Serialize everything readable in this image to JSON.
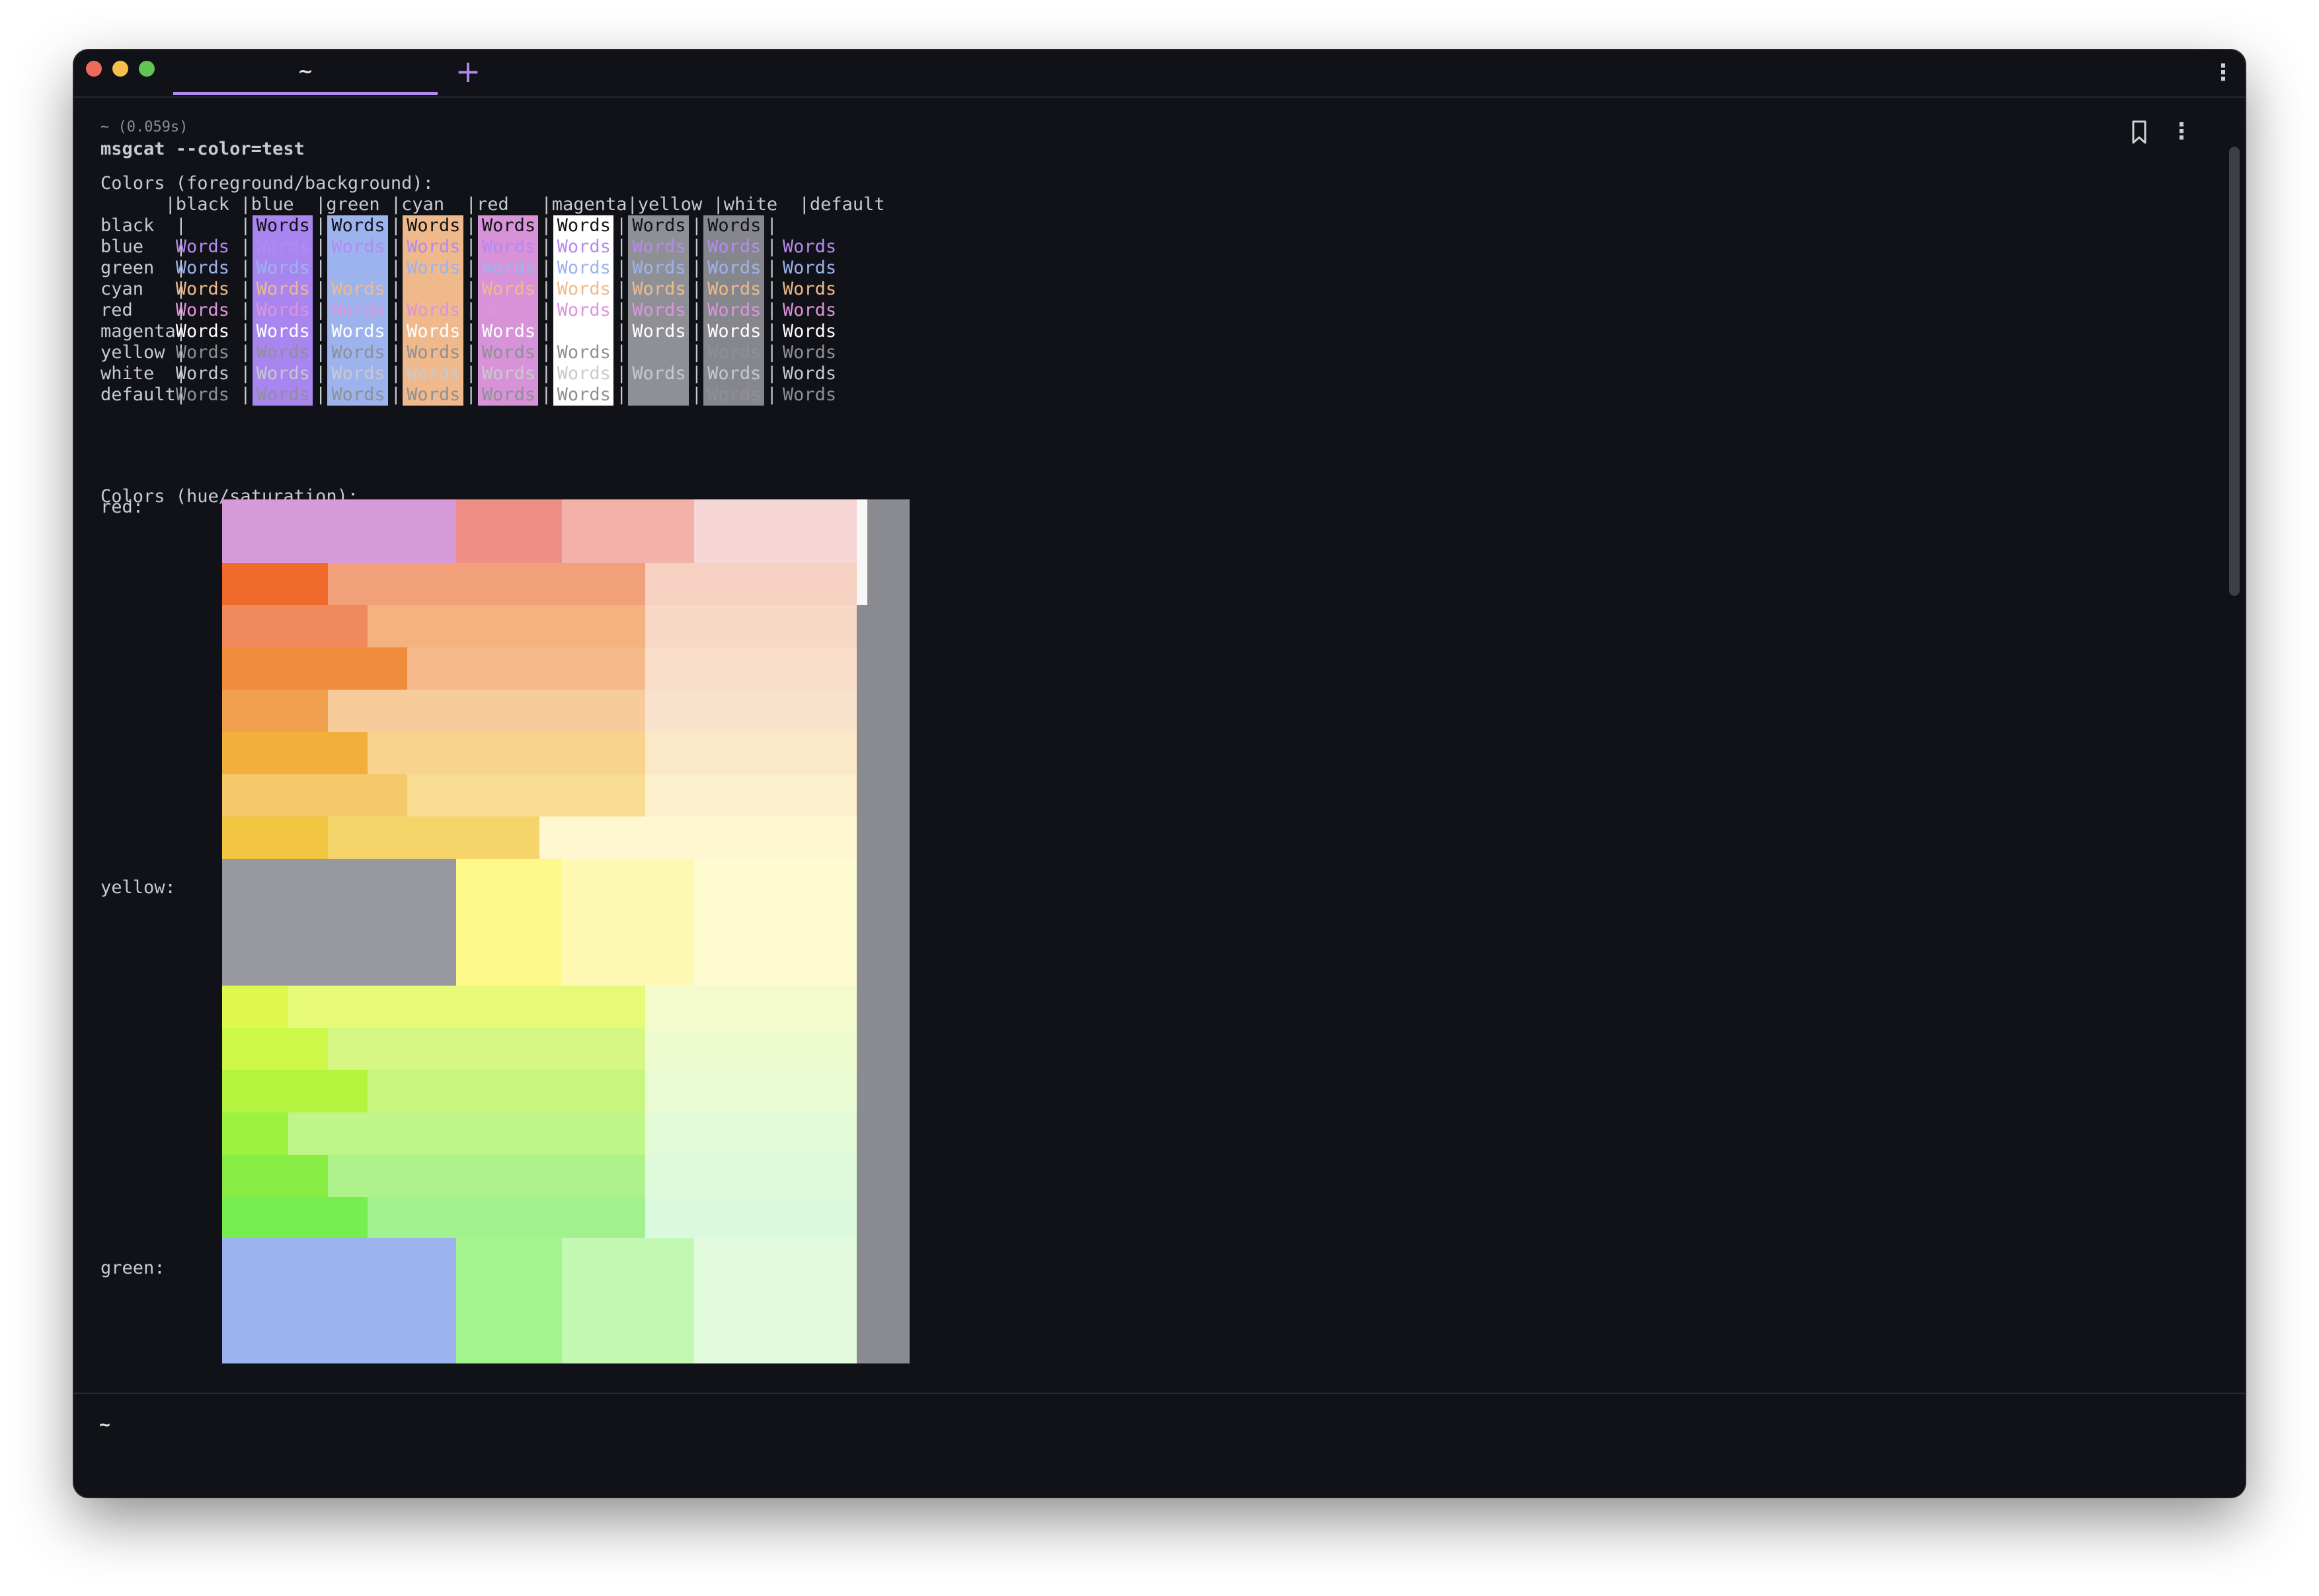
{
  "window": {
    "tab_title": "~",
    "new_tab_label": "+",
    "menu_label": "⋮"
  },
  "block": {
    "header": "~ (0.059s)",
    "command": "msgcat --color=test",
    "more_label": "⋮"
  },
  "colors_section": {
    "title": "Colors (foreground/background):",
    "column_header": "      |black |blue  |green |cyan  |red   |magenta|yellow |white  |default",
    "row_labels": [
      "black  ",
      "blue   ",
      "green  ",
      "cyan   ",
      "red    ",
      "magenta",
      "yellow ",
      "white  ",
      "default"
    ],
    "cell_text": "Words",
    "backgrounds": {
      "black": "#111217",
      "blue": "#a885ef",
      "green": "#9db3ee",
      "cyan": "#efb98c",
      "red": "#d892d8",
      "magenta": "#ffffff",
      "yellow": "#8f9096",
      "white": "#86878d",
      "default": "#111217"
    },
    "foregrounds": {
      "black": "#111217",
      "blue": "#b48af2",
      "green": "#9db3ee",
      "cyan": "#f0b98a",
      "red": "#dd94dc",
      "magenta": "#ffffff",
      "yellow": "#8f9096",
      "white": "#c8cad0",
      "default": "#8f9096"
    }
  },
  "hue_section": {
    "title": "Colors (hue/saturation):",
    "labels": [
      "red:",
      "yellow:",
      "green:"
    ]
  },
  "prompt": "~"
}
